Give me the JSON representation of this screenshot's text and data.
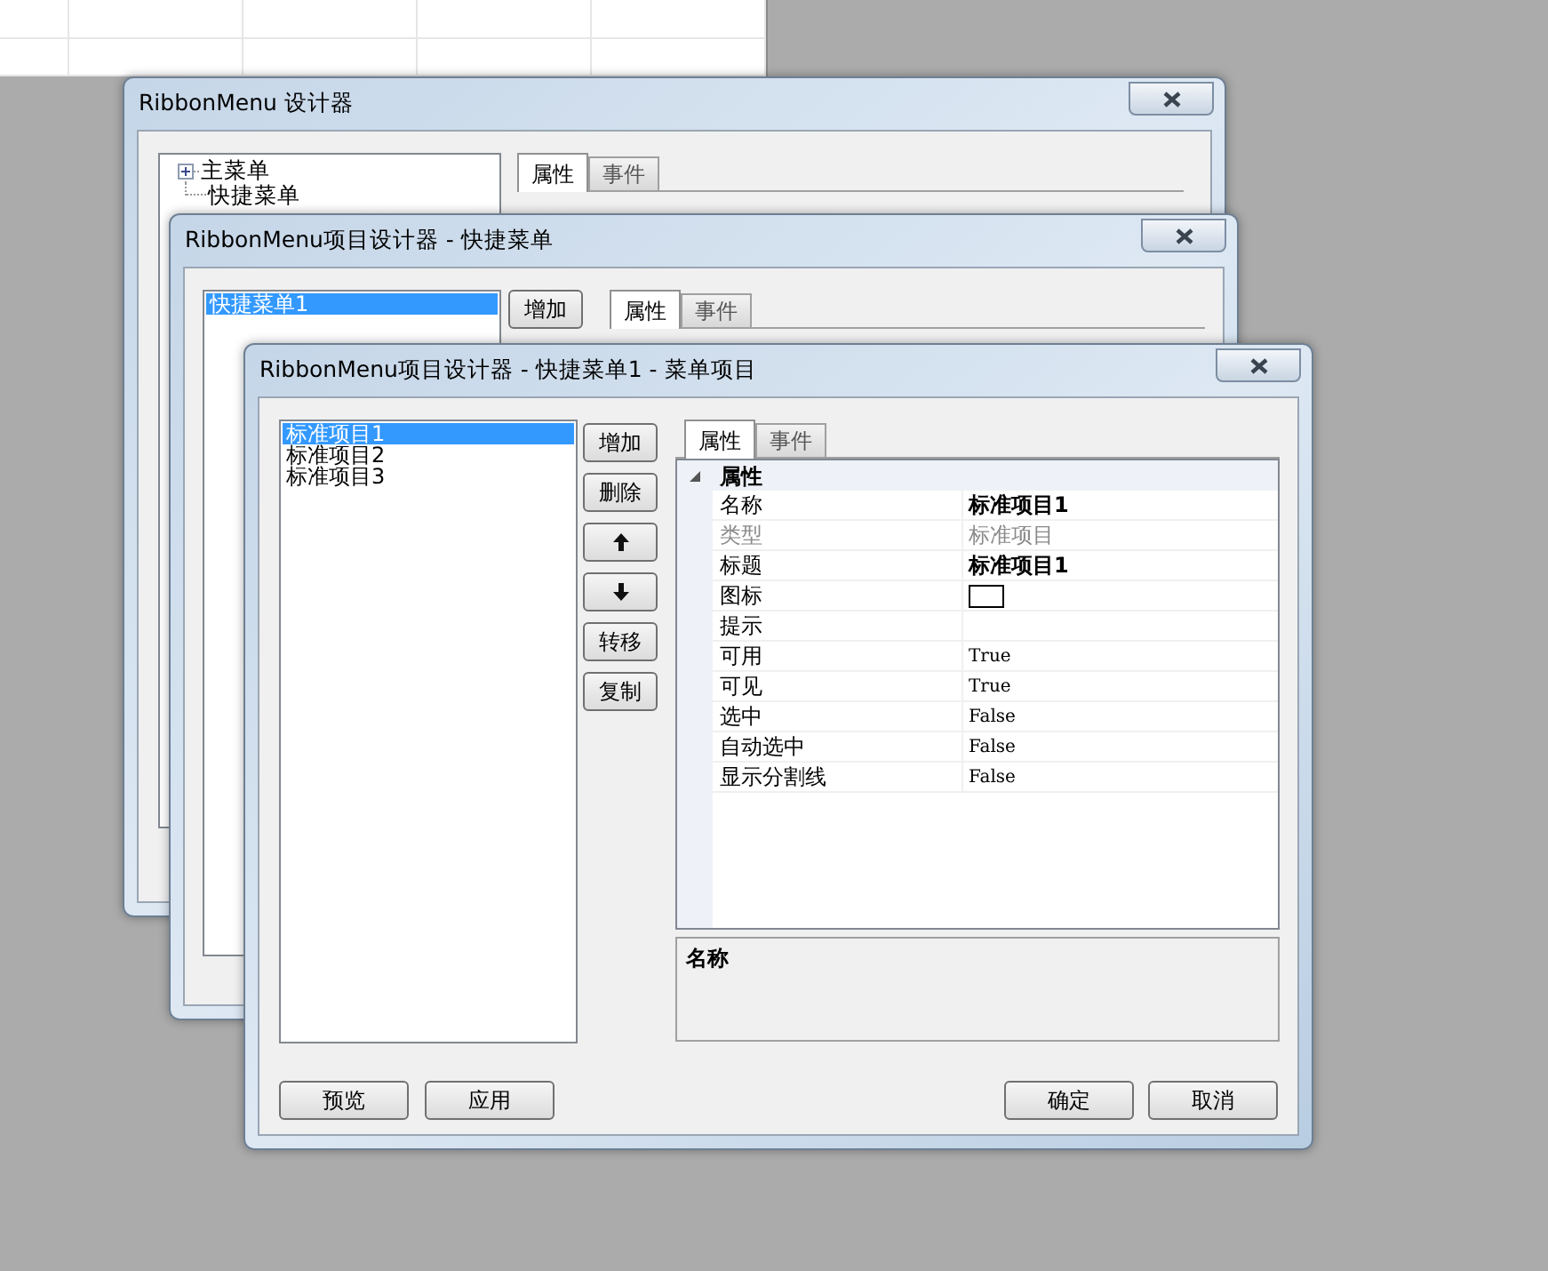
{
  "main_designer": {
    "title": "RibbonMenu 设计器",
    "tree": [
      {
        "label": "主菜单",
        "kind": "branch",
        "expanded": false
      },
      {
        "label": "快捷菜单",
        "kind": "leaf"
      }
    ],
    "tabs": [
      {
        "label": "属性",
        "selected": true
      },
      {
        "label": "事件",
        "selected": false
      }
    ]
  },
  "quick_menu_designer": {
    "title": "RibbonMenu项目设计器 - 快捷菜单",
    "items": [
      {
        "label": "快捷菜单1",
        "selected": true
      }
    ],
    "buttons": [
      "增加"
    ],
    "tabs": [
      {
        "label": "属性",
        "selected": true
      },
      {
        "label": "事件",
        "selected": false
      }
    ]
  },
  "item_designer": {
    "title": "RibbonMenu项目设计器 - 快捷菜单1 - 菜单项目",
    "items": [
      {
        "label": "标准项目1",
        "selected": true
      },
      {
        "label": "标准项目2",
        "selected": false
      },
      {
        "label": "标准项目3",
        "selected": false
      }
    ],
    "side_buttons": [
      {
        "kind": "text",
        "label": "增加"
      },
      {
        "kind": "text",
        "label": "删除"
      },
      {
        "kind": "up"
      },
      {
        "kind": "down"
      },
      {
        "kind": "text",
        "label": "转移"
      },
      {
        "kind": "text",
        "label": "复制"
      }
    ],
    "tabs": [
      {
        "label": "属性",
        "selected": true
      },
      {
        "label": "事件",
        "selected": false
      }
    ],
    "property_grid": {
      "category": "属性",
      "expanded": true,
      "rows": [
        {
          "name": "名称",
          "value": "标准项目1",
          "kind": "bold"
        },
        {
          "name": "类型",
          "value": "标准项目",
          "kind": "readonly"
        },
        {
          "name": "标题",
          "value": "标准项目1",
          "kind": "bold"
        },
        {
          "name": "图标",
          "kind": "image"
        },
        {
          "name": "提示",
          "kind": "empty"
        },
        {
          "name": "可用",
          "value": "True",
          "kind": "mono"
        },
        {
          "name": "可见",
          "value": "True",
          "kind": "mono"
        },
        {
          "name": "选中",
          "value": "False",
          "kind": "mono"
        },
        {
          "name": "自动选中",
          "value": "False",
          "kind": "mono"
        },
        {
          "name": "显示分割线",
          "value": "False",
          "kind": "mono"
        }
      ]
    },
    "description": {
      "title": "名称"
    },
    "footer_left": [
      "预览",
      "应用"
    ],
    "footer_right": [
      "确定",
      "取消"
    ]
  }
}
